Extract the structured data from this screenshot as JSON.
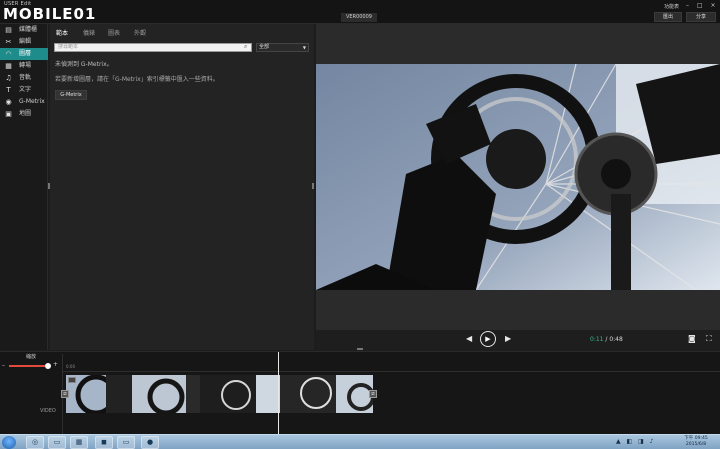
{
  "app": {
    "logo_top": "USER Edit",
    "logo_main": "MOBILE01",
    "version": "VER00009",
    "func_menu": "功能表",
    "window_controls": "– □ ×",
    "export_label": "匯出",
    "share_label": "分享"
  },
  "sidebar": {
    "items": [
      {
        "icon": "media-icon",
        "glyph": "▤",
        "label": "媒體櫃"
      },
      {
        "icon": "scissors-icon",
        "glyph": "✂",
        "label": "編輯"
      },
      {
        "icon": "gauge-icon",
        "glyph": "◠",
        "label": "圖層"
      },
      {
        "icon": "transition-icon",
        "glyph": "▦",
        "label": "轉場"
      },
      {
        "icon": "music-icon",
        "glyph": "♫",
        "label": "音軌"
      },
      {
        "icon": "text-icon",
        "glyph": "T",
        "label": "文字"
      },
      {
        "icon": "eye-icon",
        "glyph": "◉",
        "label": "G-Metrix"
      },
      {
        "icon": "map-icon",
        "glyph": "▣",
        "label": "地圖"
      }
    ],
    "active_index": 2
  },
  "panel": {
    "tabs": [
      "範本",
      "儀錶",
      "圖表",
      "外觀"
    ],
    "search_placeholder": "搜尋範本",
    "select_value": "全部",
    "not_found": "未偵測到 G-Metrix。",
    "hint": "若要新增圖層，請在「G-Metrix」索引標籤中匯入一些資料。",
    "gmetrix_button": "G-Metrix"
  },
  "player": {
    "current_time": "0:11",
    "separator": " / ",
    "total_time": "0:48",
    "prev_glyph": "◀",
    "play_glyph": "▶",
    "next_glyph": "▶",
    "camera_glyph": "◙",
    "fullscreen_glyph": "⛶"
  },
  "timeline": {
    "zoom_label": "縮放",
    "zoom_minus": "–",
    "zoom_plus": "+",
    "ruler_start": "0:00",
    "track_label": "VIDEO",
    "zoom_level": 0.9
  },
  "taskbar": {
    "apps": [
      {
        "icon": "chrome-icon",
        "glyph": "◎"
      },
      {
        "icon": "folder-icon",
        "glyph": "▭"
      },
      {
        "icon": "calculator-icon",
        "glyph": "▦"
      },
      {
        "icon": "line-icon",
        "glyph": "◼"
      },
      {
        "icon": "explorer-icon",
        "glyph": "▭"
      },
      {
        "icon": "app-icon",
        "glyph": "●"
      }
    ],
    "tray": "▲ ◧ ◨ ♪",
    "clock_time": "下午 09:45",
    "clock_date": "2015/6/8"
  },
  "colors": {
    "accent": "#1f8c8c",
    "time_current": "#38b58e",
    "zoom_fill": "#e24a3b"
  }
}
